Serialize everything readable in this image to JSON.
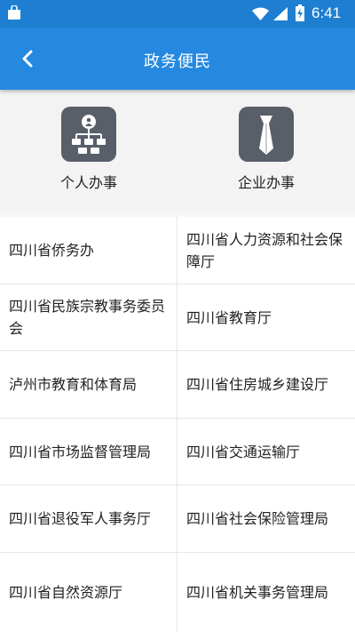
{
  "status_bar": {
    "time": "6:41",
    "icons": [
      "shopping-bag-icon",
      "wifi-icon",
      "signal-icon",
      "battery-charging-icon"
    ]
  },
  "header": {
    "title": "政务便民",
    "back_icon": "chevron-left-icon"
  },
  "shortcuts": [
    {
      "label": "个人办事",
      "icon": "org-chart-icon"
    },
    {
      "label": "企业办事",
      "icon": "necktie-icon"
    }
  ],
  "departments": [
    [
      "四川省侨务办",
      "四川省人力资源和社会保障厅"
    ],
    [
      "四川省民族宗教事务委员会",
      "四川省教育厅"
    ],
    [
      "泸州市教育和体育局",
      "四川省住房城乡建设厅"
    ],
    [
      "四川省市场监督管理局",
      "四川省交通运输厅"
    ],
    [
      "四川省退役军人事务厅",
      "四川省社会保险管理局"
    ],
    [
      "四川省自然资源厅",
      "四川省机关事务管理局"
    ]
  ],
  "colors": {
    "status_bar": "#1e7fd2",
    "app_bar": "#2589e0",
    "tile": "#585f69",
    "background": "#f3f3f3"
  }
}
